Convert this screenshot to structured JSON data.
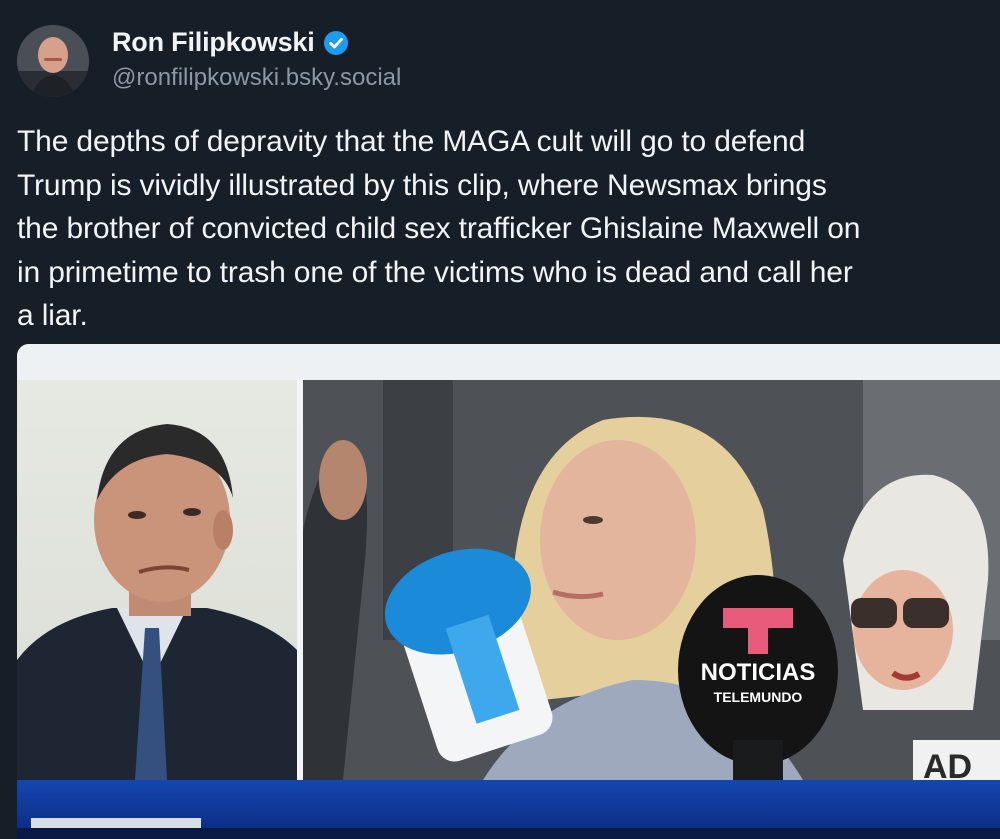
{
  "author": {
    "display_name": "Ron Filipkowski",
    "handle": "@ronfilipkowski.bsky.social",
    "verified_badge_icon": "verified-check-icon",
    "badge_color": "#1d9bf0"
  },
  "post": {
    "text": "The depths of depravity that the MAGA cult will go to defend\nTrump is vividly illustrated by this clip, where Newsmax brings\nthe brother of convicted child sex trafficker Ghislaine Maxwell on\nin primetime to trash one of the victims who is dead and call her\na liar."
  },
  "video": {
    "mic_left_logo": "",
    "mic_right_brand_line1": "NOTICIAS",
    "mic_right_brand_line2": "TELEMUNDO",
    "mic_right_logo_letter": "T",
    "corner_text": "AD"
  },
  "colors": {
    "background": "#161e27",
    "text_primary": "#f1f3f5",
    "text_secondary": "#8b98a5",
    "newsmax_blue": "#1546b0"
  }
}
